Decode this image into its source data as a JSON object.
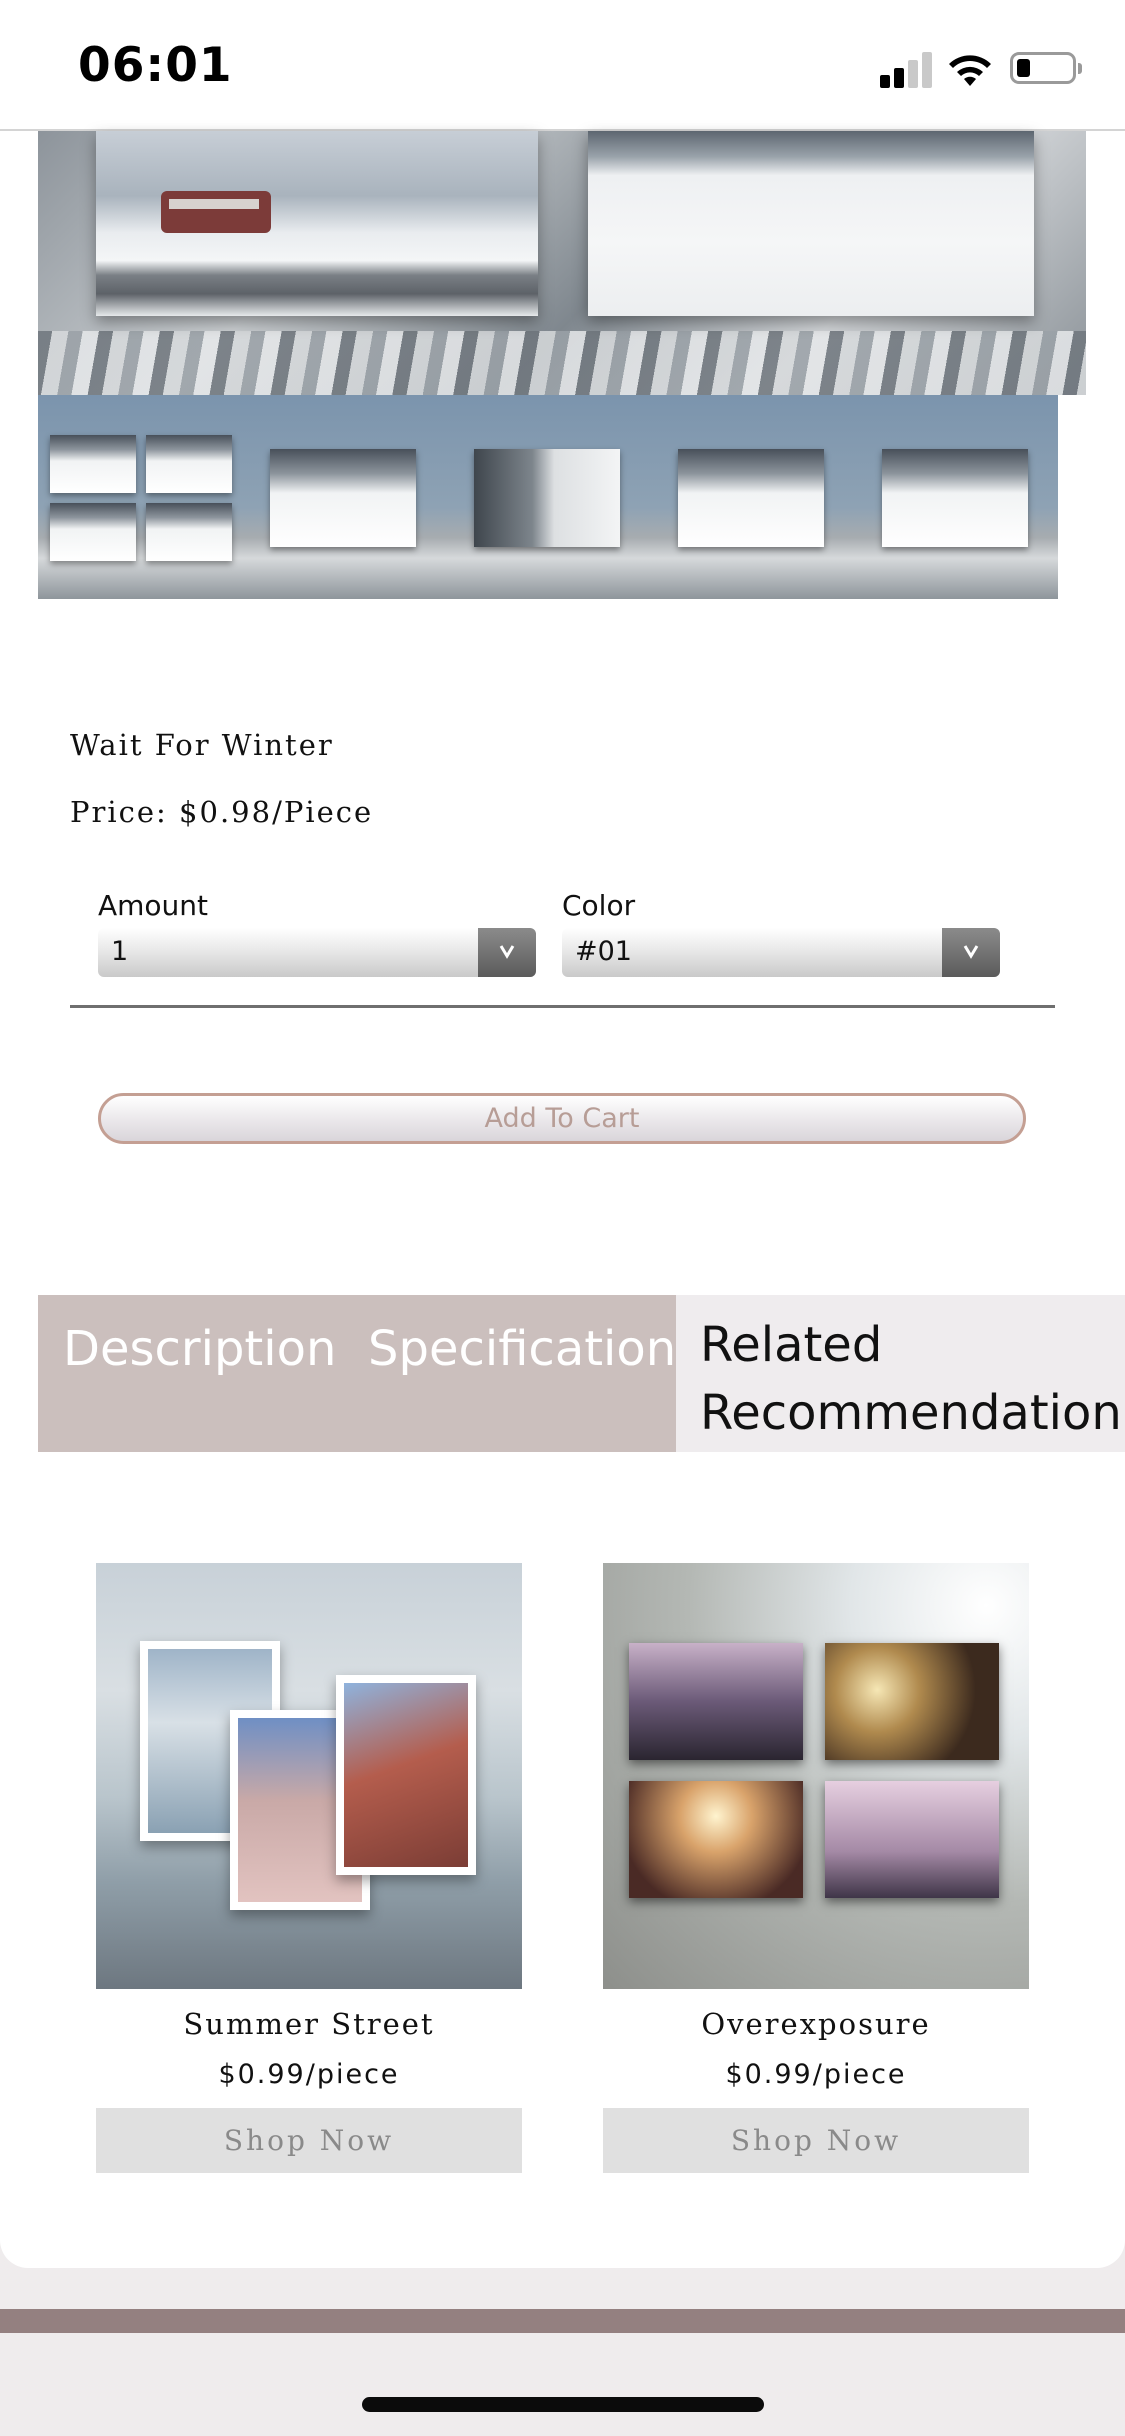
{
  "status_bar": {
    "time": "06:01"
  },
  "product": {
    "title": "Wait For Winter",
    "price": "Price: $0.98/Piece",
    "amount": {
      "label": "Amount",
      "value": "1"
    },
    "color": {
      "label": "Color",
      "value": "#01"
    },
    "add_to_cart": "Add To Cart"
  },
  "tabs": [
    {
      "label": "Description",
      "active": false
    },
    {
      "label": "Specification",
      "active": false
    },
    {
      "label": "Related Recommendation",
      "active": true
    }
  ],
  "related": [
    {
      "name": "Summer Street",
      "price": "$0.99/piece",
      "button": "Shop Now"
    },
    {
      "name": "Overexposure",
      "price": "$0.99/piece",
      "button": "Shop Now"
    }
  ],
  "icons": {
    "signal": "cellular-signal-icon",
    "wifi": "wifi-icon",
    "battery": "battery-icon",
    "dropdown": "chevron-down-icon"
  },
  "colors": {
    "tab_inactive_bg": "#cbbfbd",
    "tab_active_bg": "#efecee",
    "cart_border": "#c49f93",
    "footer_bar": "#948080"
  }
}
